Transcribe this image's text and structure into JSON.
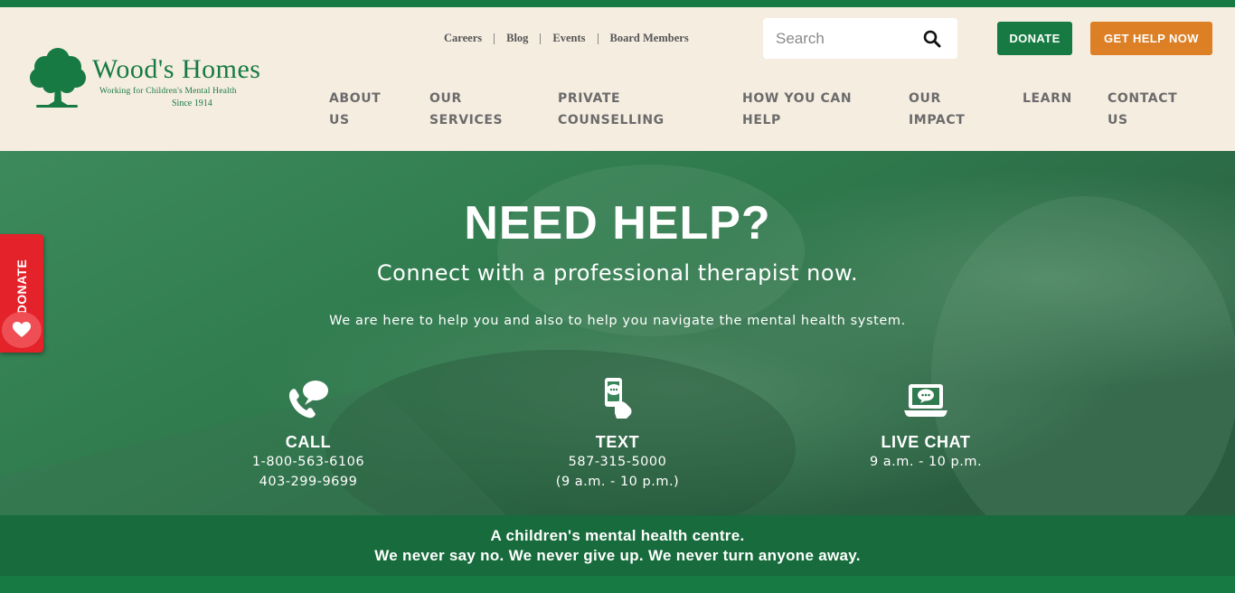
{
  "header": {
    "logo": {
      "name": "Wood's Homes",
      "tagline": "Working for Children's Mental Health",
      "since": "Since 1914"
    },
    "utility_links": [
      "Careers",
      "Blog",
      "Events",
      "Board Members"
    ],
    "search": {
      "placeholder": "Search",
      "icon": "search-icon"
    },
    "donate_label": "DONATE",
    "get_help_label": "GET HELP NOW",
    "nav": [
      {
        "line1": "ABOUT",
        "line2": "US"
      },
      {
        "line1": "OUR",
        "line2": "SERVICES"
      },
      {
        "line1": "PRIVATE",
        "line2": "COUNSELLING"
      },
      {
        "line1": "HOW YOU CAN",
        "line2": "HELP"
      },
      {
        "line1": "OUR",
        "line2": "IMPACT"
      },
      {
        "line1": "LEARN",
        "line2": ""
      },
      {
        "line1": "CONTACT",
        "line2": "US"
      }
    ]
  },
  "hero": {
    "title": "NEED HELP?",
    "subtitle": "Connect with a professional therapist now.",
    "text": "We are here to help you and also to help you navigate the mental health system.",
    "contacts": [
      {
        "icon": "phone-chat-icon",
        "title": "CALL",
        "lines": [
          "1-800-563-6106",
          "403-299-9699"
        ]
      },
      {
        "icon": "mobile-text-icon",
        "title": "TEXT",
        "lines": [
          "587-315-5000",
          "(9 a.m. - 10 p.m.)"
        ]
      },
      {
        "icon": "laptop-chat-icon",
        "title": "LIVE CHAT",
        "lines": [
          "9 a.m. - 10 p.m."
        ]
      }
    ]
  },
  "band": {
    "line1": "A children's mental health centre.",
    "line2": "We never say no. We never give up. We never turn anyone away."
  },
  "floating_donate": {
    "label": "DONATE",
    "icon": "heart-icon"
  },
  "colors": {
    "brand_green": "#167a42",
    "band_green": "#176b3c",
    "orange": "#dd7f24",
    "cream": "#f6ede1",
    "donate_red": "#e4222a"
  }
}
